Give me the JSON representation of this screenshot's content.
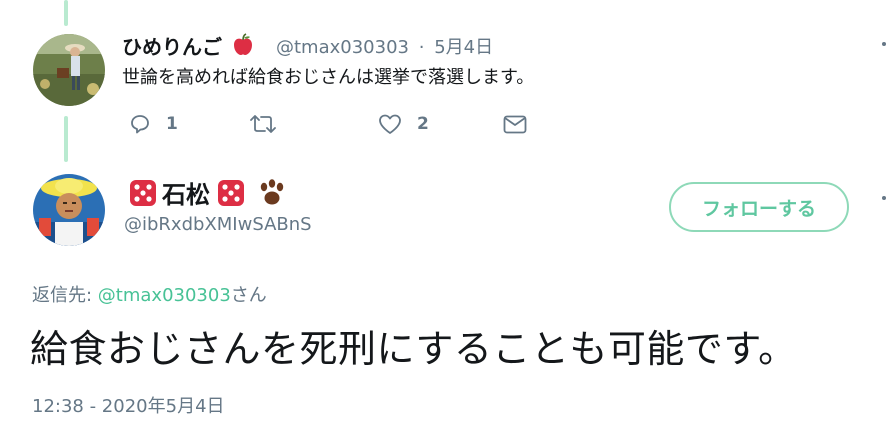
{
  "reply_tweet": {
    "display_name": "ひめりんご",
    "name_emoji": "apple-emoji",
    "handle": "@tmax030303",
    "separator": "·",
    "date": "5月4日",
    "text": "世論を高めれば給食おじさんは選挙で落選します。",
    "actions": {
      "reply_count": "1",
      "retweet_count": "",
      "like_count": "2"
    }
  },
  "main_tweet": {
    "display_name": "石松",
    "handle": "@ibRxdbXMIwSABnS",
    "follow_label": "フォローする",
    "reply_to_prefix": "返信先: ",
    "reply_to_mention": "@tmax030303",
    "reply_to_suffix": "さん",
    "text": "給食おじさんを死刑にすることも可能です。",
    "timestamp": "12:38 - 2020年5月4日"
  },
  "colors": {
    "accent": "#5fc7a0",
    "thread_line": "#b9ead0",
    "secondary_text": "#657786"
  },
  "icons": [
    "reply-icon",
    "retweet-icon",
    "like-icon",
    "dm-icon",
    "dice-icon",
    "paw-icon",
    "apple-icon"
  ]
}
